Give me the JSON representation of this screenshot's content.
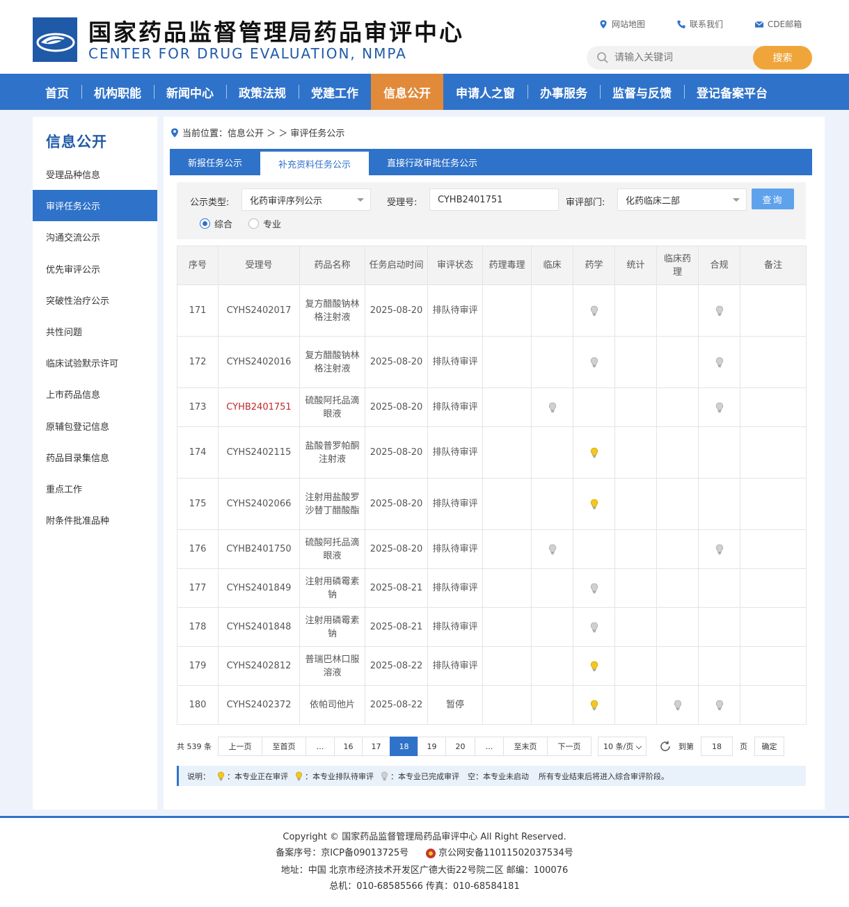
{
  "header": {
    "title": "国家药品监督管理局药品审评中心",
    "subtitle": "CENTER FOR DRUG EVALUATION, NMPA",
    "links": [
      {
        "label": "网站地图",
        "icon": "map-pin-icon"
      },
      {
        "label": "联系我们",
        "icon": "phone-icon"
      },
      {
        "label": "CDE邮箱",
        "icon": "mail-icon"
      }
    ],
    "search": {
      "placeholder": "请输入关键词",
      "button": "搜索"
    }
  },
  "nav": {
    "items": [
      "首页",
      "机构职能",
      "新闻中心",
      "政策法规",
      "党建工作",
      "信息公开",
      "申请人之窗",
      "办事服务",
      "监督与反馈",
      "登记备案平台"
    ],
    "active_index": 5,
    "active_color": "#e18a3a",
    "bar_color": "#2f72c9"
  },
  "sidebar": {
    "title": "信息公开",
    "items": [
      "受理品种信息",
      "审评任务公示",
      "沟通交流公示",
      "优先审评公示",
      "突破性治疗公示",
      "共性问题",
      "临床试验默示许可",
      "上市药品信息",
      "原辅包登记信息",
      "药品目录集信息",
      "重点工作",
      "附条件批准品种"
    ],
    "active_index": 1
  },
  "breadcrumb": {
    "label": "当前位置：信息公开 ＞ ＞ 审评任务公示"
  },
  "tabs": {
    "items": [
      "新报任务公示",
      "补充资料任务公示",
      "直接行政审批任务公示"
    ],
    "active_index": 1
  },
  "filter": {
    "type_label": "公示类型:",
    "type_value": "化药审评序列公示",
    "acceptance_label": "受理号:",
    "acceptance_value": "CYHB2401751",
    "dept_label": "审评部门:",
    "dept_value": "化药临床二部",
    "query_button": "查询",
    "radios": [
      {
        "label": "综合",
        "checked": true
      },
      {
        "label": "专业",
        "checked": false
      }
    ]
  },
  "table": {
    "columns": [
      "序号",
      "受理号",
      "药品名称",
      "任务启动时间",
      "审评状态",
      "药理毒理",
      "临床",
      "药学",
      "统计",
      "临床药理",
      "合规",
      "备注"
    ],
    "bulb_colors": {
      "active": "#f2c81f",
      "queued": "#f2c81f",
      "done": "#d0d0d0"
    },
    "rows": [
      {
        "no": "171",
        "id": "CYHS2402017",
        "name": "复方醋酸钠林格注射液",
        "date": "2025-08-20",
        "status": "排队待审评",
        "highlight": false,
        "bulbs": {
          "pharm_tox": "",
          "clinical": "",
          "pharmacy": "done",
          "stats": "",
          "clin_pharm": "",
          "compliance": "done"
        }
      },
      {
        "no": "172",
        "id": "CYHS2402016",
        "name": "复方醋酸钠林格注射液",
        "date": "2025-08-20",
        "status": "排队待审评",
        "highlight": false,
        "bulbs": {
          "pharm_tox": "",
          "clinical": "",
          "pharmacy": "done",
          "stats": "",
          "clin_pharm": "",
          "compliance": "done"
        }
      },
      {
        "no": "173",
        "id": "CYHB2401751",
        "name": "硫酸阿托品滴眼液",
        "date": "2025-08-20",
        "status": "排队待审评",
        "highlight": true,
        "bulbs": {
          "pharm_tox": "",
          "clinical": "done",
          "pharmacy": "",
          "stats": "",
          "clin_pharm": "",
          "compliance": "done"
        }
      },
      {
        "no": "174",
        "id": "CYHS2402115",
        "name": "盐酸普罗帕酮注射液",
        "date": "2025-08-20",
        "status": "排队待审评",
        "highlight": false,
        "bulbs": {
          "pharm_tox": "",
          "clinical": "",
          "pharmacy": "active",
          "stats": "",
          "clin_pharm": "",
          "compliance": ""
        }
      },
      {
        "no": "175",
        "id": "CYHS2402066",
        "name": "注射用盐酸罗沙替丁醋酸酯",
        "date": "2025-08-20",
        "status": "排队待审评",
        "highlight": false,
        "bulbs": {
          "pharm_tox": "",
          "clinical": "",
          "pharmacy": "active",
          "stats": "",
          "clin_pharm": "",
          "compliance": ""
        }
      },
      {
        "no": "176",
        "id": "CYHB2401750",
        "name": "硫酸阿托品滴眼液",
        "date": "2025-08-20",
        "status": "排队待审评",
        "highlight": false,
        "bulbs": {
          "pharm_tox": "",
          "clinical": "done",
          "pharmacy": "",
          "stats": "",
          "clin_pharm": "",
          "compliance": "done"
        }
      },
      {
        "no": "177",
        "id": "CYHS2401849",
        "name": "注射用磷霉素钠",
        "date": "2025-08-21",
        "status": "排队待审评",
        "highlight": false,
        "bulbs": {
          "pharm_tox": "",
          "clinical": "",
          "pharmacy": "done",
          "stats": "",
          "clin_pharm": "",
          "compliance": ""
        }
      },
      {
        "no": "178",
        "id": "CYHS2401848",
        "name": "注射用磷霉素钠",
        "date": "2025-08-21",
        "status": "排队待审评",
        "highlight": false,
        "bulbs": {
          "pharm_tox": "",
          "clinical": "",
          "pharmacy": "done",
          "stats": "",
          "clin_pharm": "",
          "compliance": ""
        }
      },
      {
        "no": "179",
        "id": "CYHS2402812",
        "name": "普瑞巴林口服溶液",
        "date": "2025-08-22",
        "status": "排队待审评",
        "highlight": false,
        "bulbs": {
          "pharm_tox": "",
          "clinical": "",
          "pharmacy": "active",
          "stats": "",
          "clin_pharm": "",
          "compliance": ""
        }
      },
      {
        "no": "180",
        "id": "CYHS2402372",
        "name": "依帕司他片",
        "date": "2025-08-22",
        "status": "暂停",
        "highlight": false,
        "bulbs": {
          "pharm_tox": "",
          "clinical": "",
          "pharmacy": "active",
          "stats": "",
          "clin_pharm": "done",
          "compliance": "done"
        }
      }
    ]
  },
  "pager": {
    "total": "共 539 条",
    "prev": "上一页",
    "first": "至首页",
    "ellipsis": "…",
    "pages": [
      "16",
      "17",
      "18",
      "19",
      "20"
    ],
    "current": "18",
    "last": "至末页",
    "next": "下一页",
    "page_size": "10 条/页",
    "goto_label": "到第",
    "goto_value": "18",
    "page_label": "页",
    "confirm": "确定"
  },
  "legend": {
    "label": "说明：",
    "items": [
      {
        "bulb": "active",
        "text": "：本专业正在审评"
      },
      {
        "bulb": "queued",
        "text": "：本专业排队待审评"
      },
      {
        "bulb": "done",
        "text": "：本专业已完成审评"
      }
    ],
    "empty_text": "空：本专业未启动",
    "note": "所有专业结束后将进入综合审评阶段。"
  },
  "footer": {
    "copyright": "Copyright © 国家药品监督管理局药品审评中心    All Right Reserved.",
    "icp": "备案序号：京ICP备09013725号",
    "police": "京公网安备11011502037534号",
    "address": "地址：中国 北京市经济技术开发区广德大街22号院二区     邮编：100076",
    "phones": "总机：010-68585566      传真：010-68584181"
  }
}
